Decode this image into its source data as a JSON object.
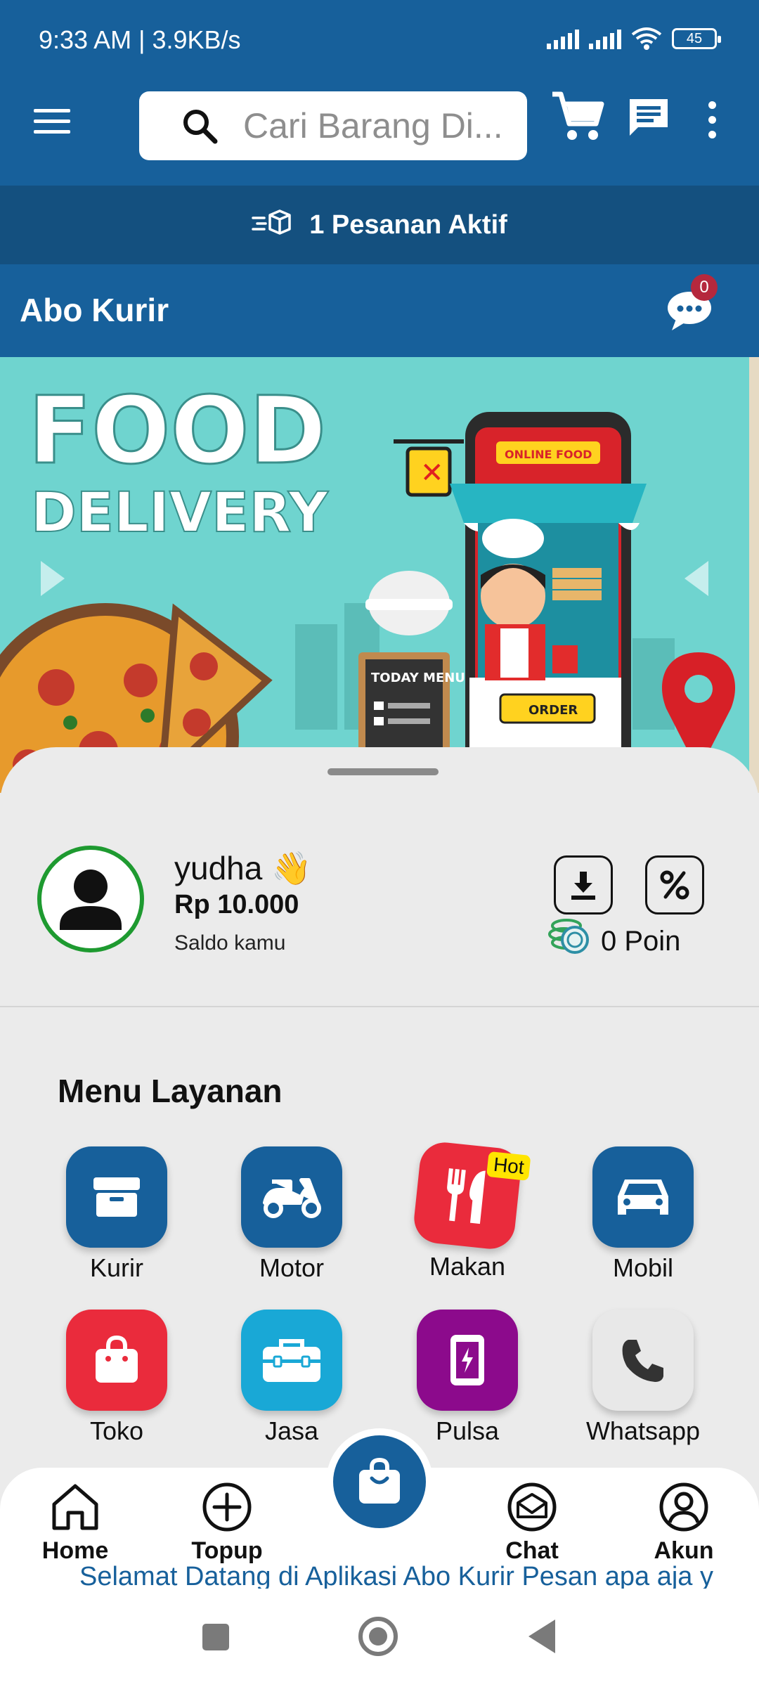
{
  "status_bar": {
    "time": "9:33 AM | 3.9KB/s",
    "battery": "45"
  },
  "header": {
    "search_placeholder": "Cari Barang Di..."
  },
  "active_orders": {
    "label": "1 Pesanan Aktif"
  },
  "title_bar": {
    "title": "Abo Kurir",
    "chat_badge": "0"
  },
  "banner": {
    "headline": "FOOD",
    "subheadline": "DELIVERY",
    "sign": "ONLINE FOOD",
    "board": "TODAY MENU",
    "order": "ORDER"
  },
  "profile": {
    "name": "yudha 👋",
    "balance": "Rp 10.000",
    "balance_label": "Saldo kamu",
    "points": "0 Poin"
  },
  "services": {
    "title": "Menu Layanan",
    "hot_badge": "Hot",
    "items": [
      {
        "label": "Kurir",
        "icon": "box-icon",
        "color": "#17609b"
      },
      {
        "label": "Motor",
        "icon": "scooter-icon",
        "color": "#17609b"
      },
      {
        "label": "Makan",
        "icon": "food-icon",
        "color": "#ea2b3c"
      },
      {
        "label": "Mobil",
        "icon": "car-icon",
        "color": "#17609b"
      },
      {
        "label": "Toko",
        "icon": "shopping-bag-icon",
        "color": "#ea2b3c"
      },
      {
        "label": "Jasa",
        "icon": "toolbox-icon",
        "color": "#19a8d6"
      },
      {
        "label": "Pulsa",
        "icon": "phone-charge-icon",
        "color": "#8c0a8c"
      },
      {
        "label": "Whatsapp",
        "icon": "phone-icon",
        "color": "#e8e8e8"
      }
    ]
  },
  "bottom_nav": {
    "home": "Home",
    "topup": "Topup",
    "chat": "Chat",
    "account": "Akun"
  },
  "marquee": "Selamat Datang di Aplikasi Abo Kurir Pesan apa aja y"
}
